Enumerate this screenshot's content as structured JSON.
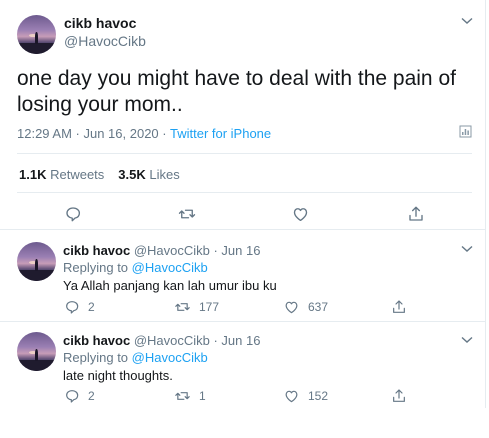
{
  "main_tweet": {
    "name": "cikb havoc",
    "handle": "@HavocCikb",
    "text": "one day you might have to deal with the pain of losing your mom..",
    "time": "12:29 AM · Jun 16, 2020",
    "dot": " · ",
    "source": "Twitter for iPhone",
    "retweets_count": "1.1K",
    "retweets_label": "Retweets",
    "likes_count": "3.5K",
    "likes_label": "Likes"
  },
  "replies": [
    {
      "name": "cikb havoc",
      "meta": "@HavocCikb · Jun 16",
      "replying_prefix": "Replying to ",
      "replying_handle": "@HavocCikb",
      "text": "Ya Allah panjang kan lah umur ibu ku",
      "reply_count": "2",
      "retweet_count": "177",
      "like_count": "637"
    },
    {
      "name": "cikb havoc",
      "meta": "@HavocCikb · Jun 16",
      "replying_prefix": "Replying to ",
      "replying_handle": "@HavocCikb",
      "text": "late night thoughts.",
      "reply_count": "2",
      "retweet_count": "1",
      "like_count": "152"
    }
  ],
  "colors": {
    "accent": "#1da1f2",
    "secondary_text": "#657786",
    "primary_text": "#14171a",
    "divider": "#e6ecf0"
  },
  "icons": [
    "chevron-down-icon",
    "analytics-icon",
    "reply-icon",
    "retweet-icon",
    "like-icon",
    "share-icon"
  ]
}
